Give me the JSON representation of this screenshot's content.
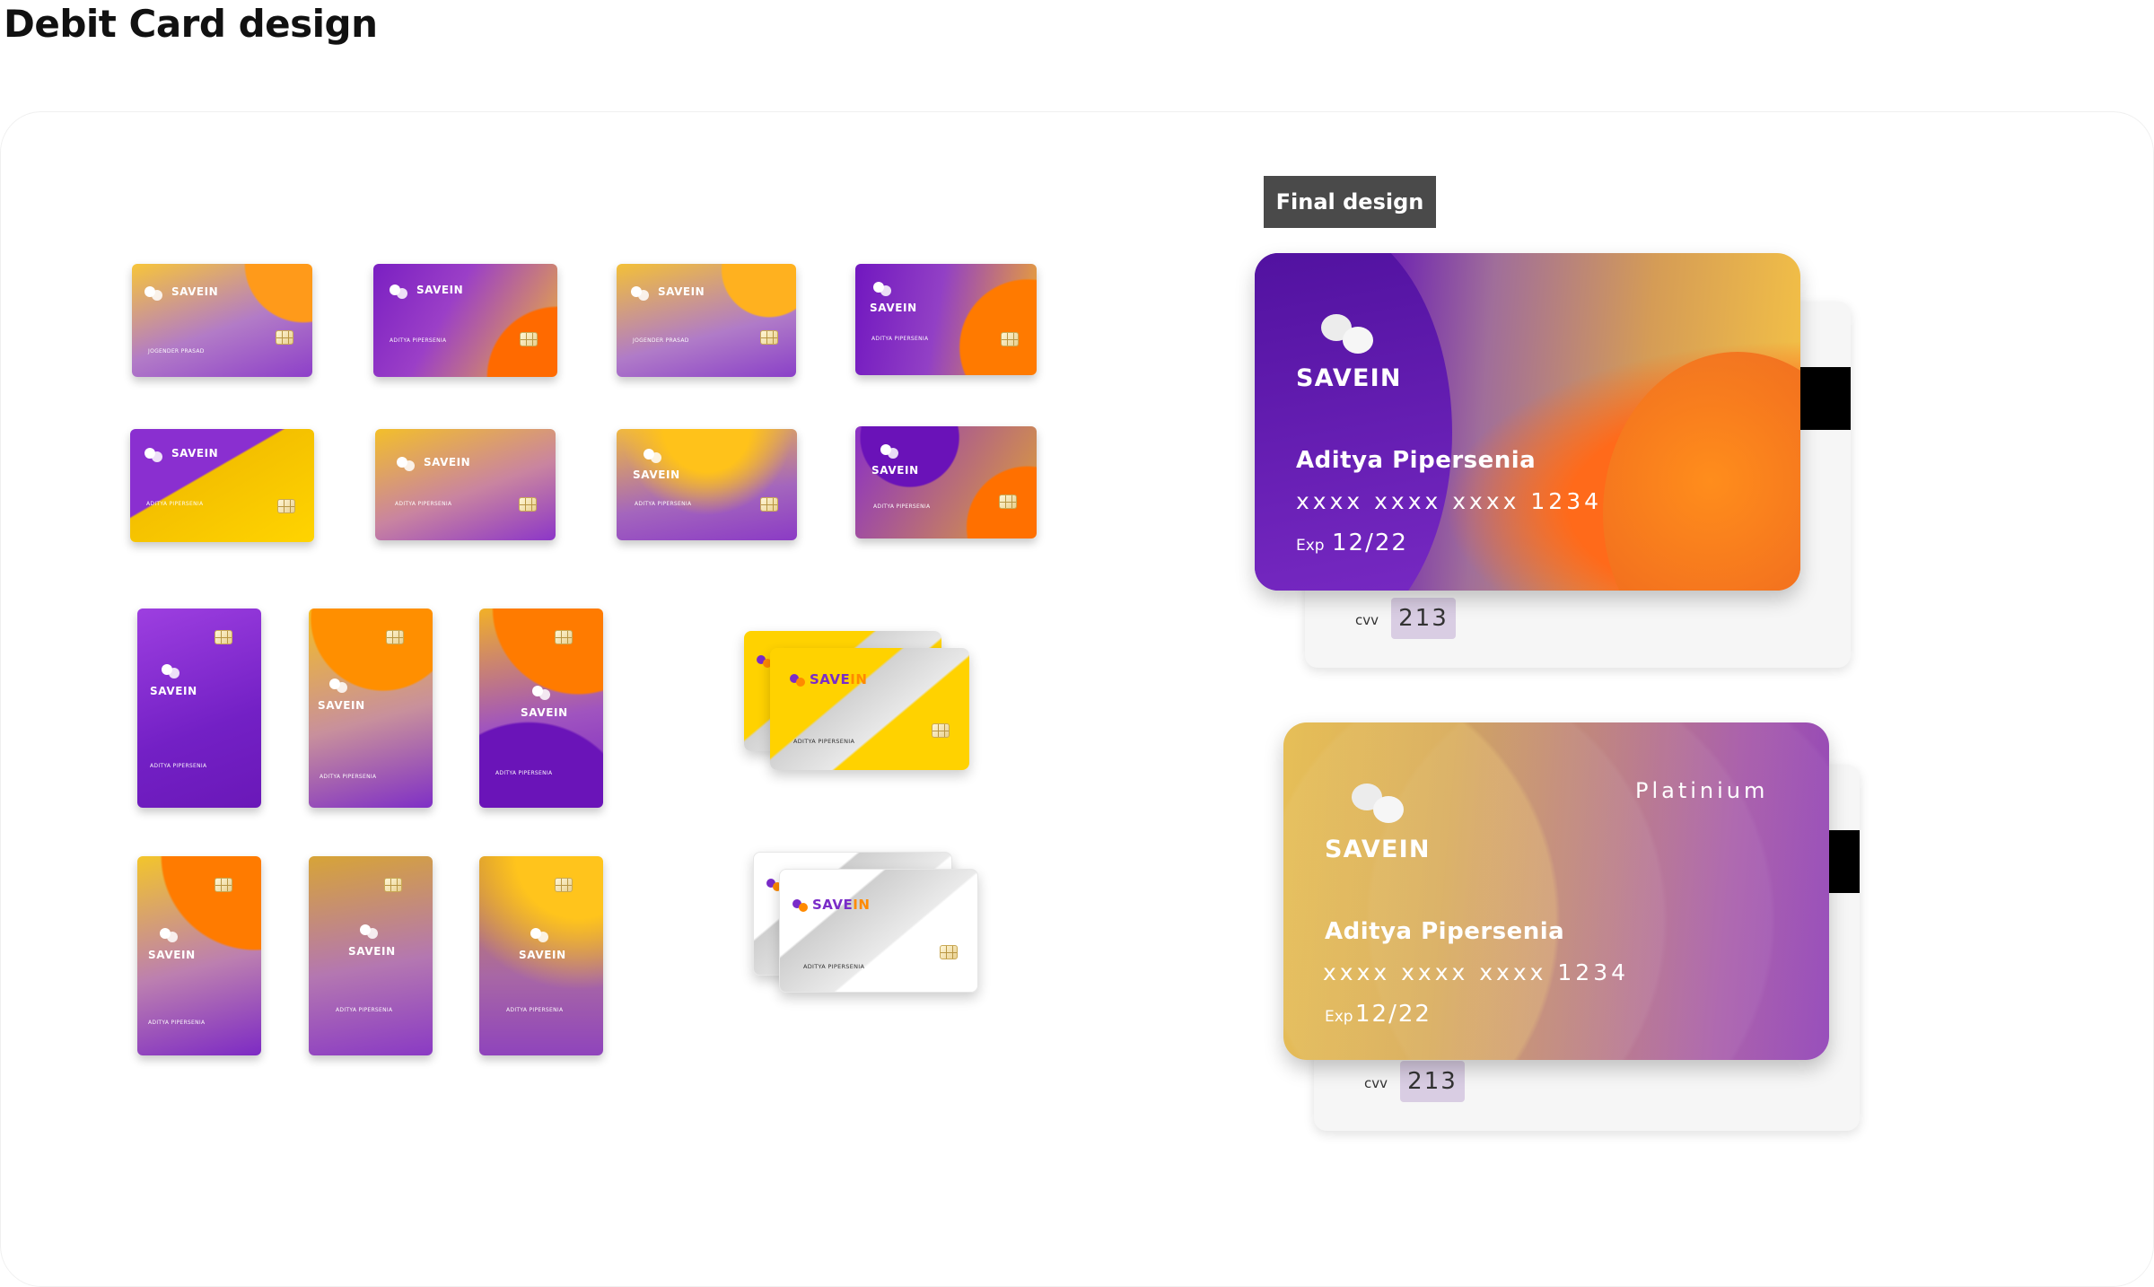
{
  "page": {
    "title": "Debit Card design"
  },
  "variations": {
    "brand": "SAVEIN",
    "holder_a": "JOGENDER PRASAD",
    "holder_b": "ADITYA PIPERSENIA",
    "holder_c": "Aditya Pipersenia",
    "icons": [
      "logo-mark",
      "chip-icon"
    ]
  },
  "mockups": {
    "brand_part1": "SAVE",
    "brand_part2": "IN",
    "holder": "ADITYA PIPERSENIA"
  },
  "final": {
    "label": "Final design",
    "card1": {
      "brand": "SAVEIN",
      "holder": "Aditya Pipersenia",
      "number": "xxxx xxxx xxxx 1234",
      "exp_label": "Exp",
      "exp_value": "12/22",
      "cvv_label": "cvv",
      "cvv_value": "213"
    },
    "card2": {
      "brand": "SAVEIN",
      "tier": "Platinium",
      "holder": "Aditya Pipersenia",
      "number": "xxxx xxxx xxxx 1234",
      "exp_label": "Exp",
      "exp_value": "12/22",
      "cvv_label": "cvv",
      "cvv_value": "213"
    }
  },
  "colors": {
    "purple": "#7a2cc8",
    "orange": "#ff8a00",
    "yellow": "#ffd200",
    "label_bg": "#4a4a4a"
  }
}
